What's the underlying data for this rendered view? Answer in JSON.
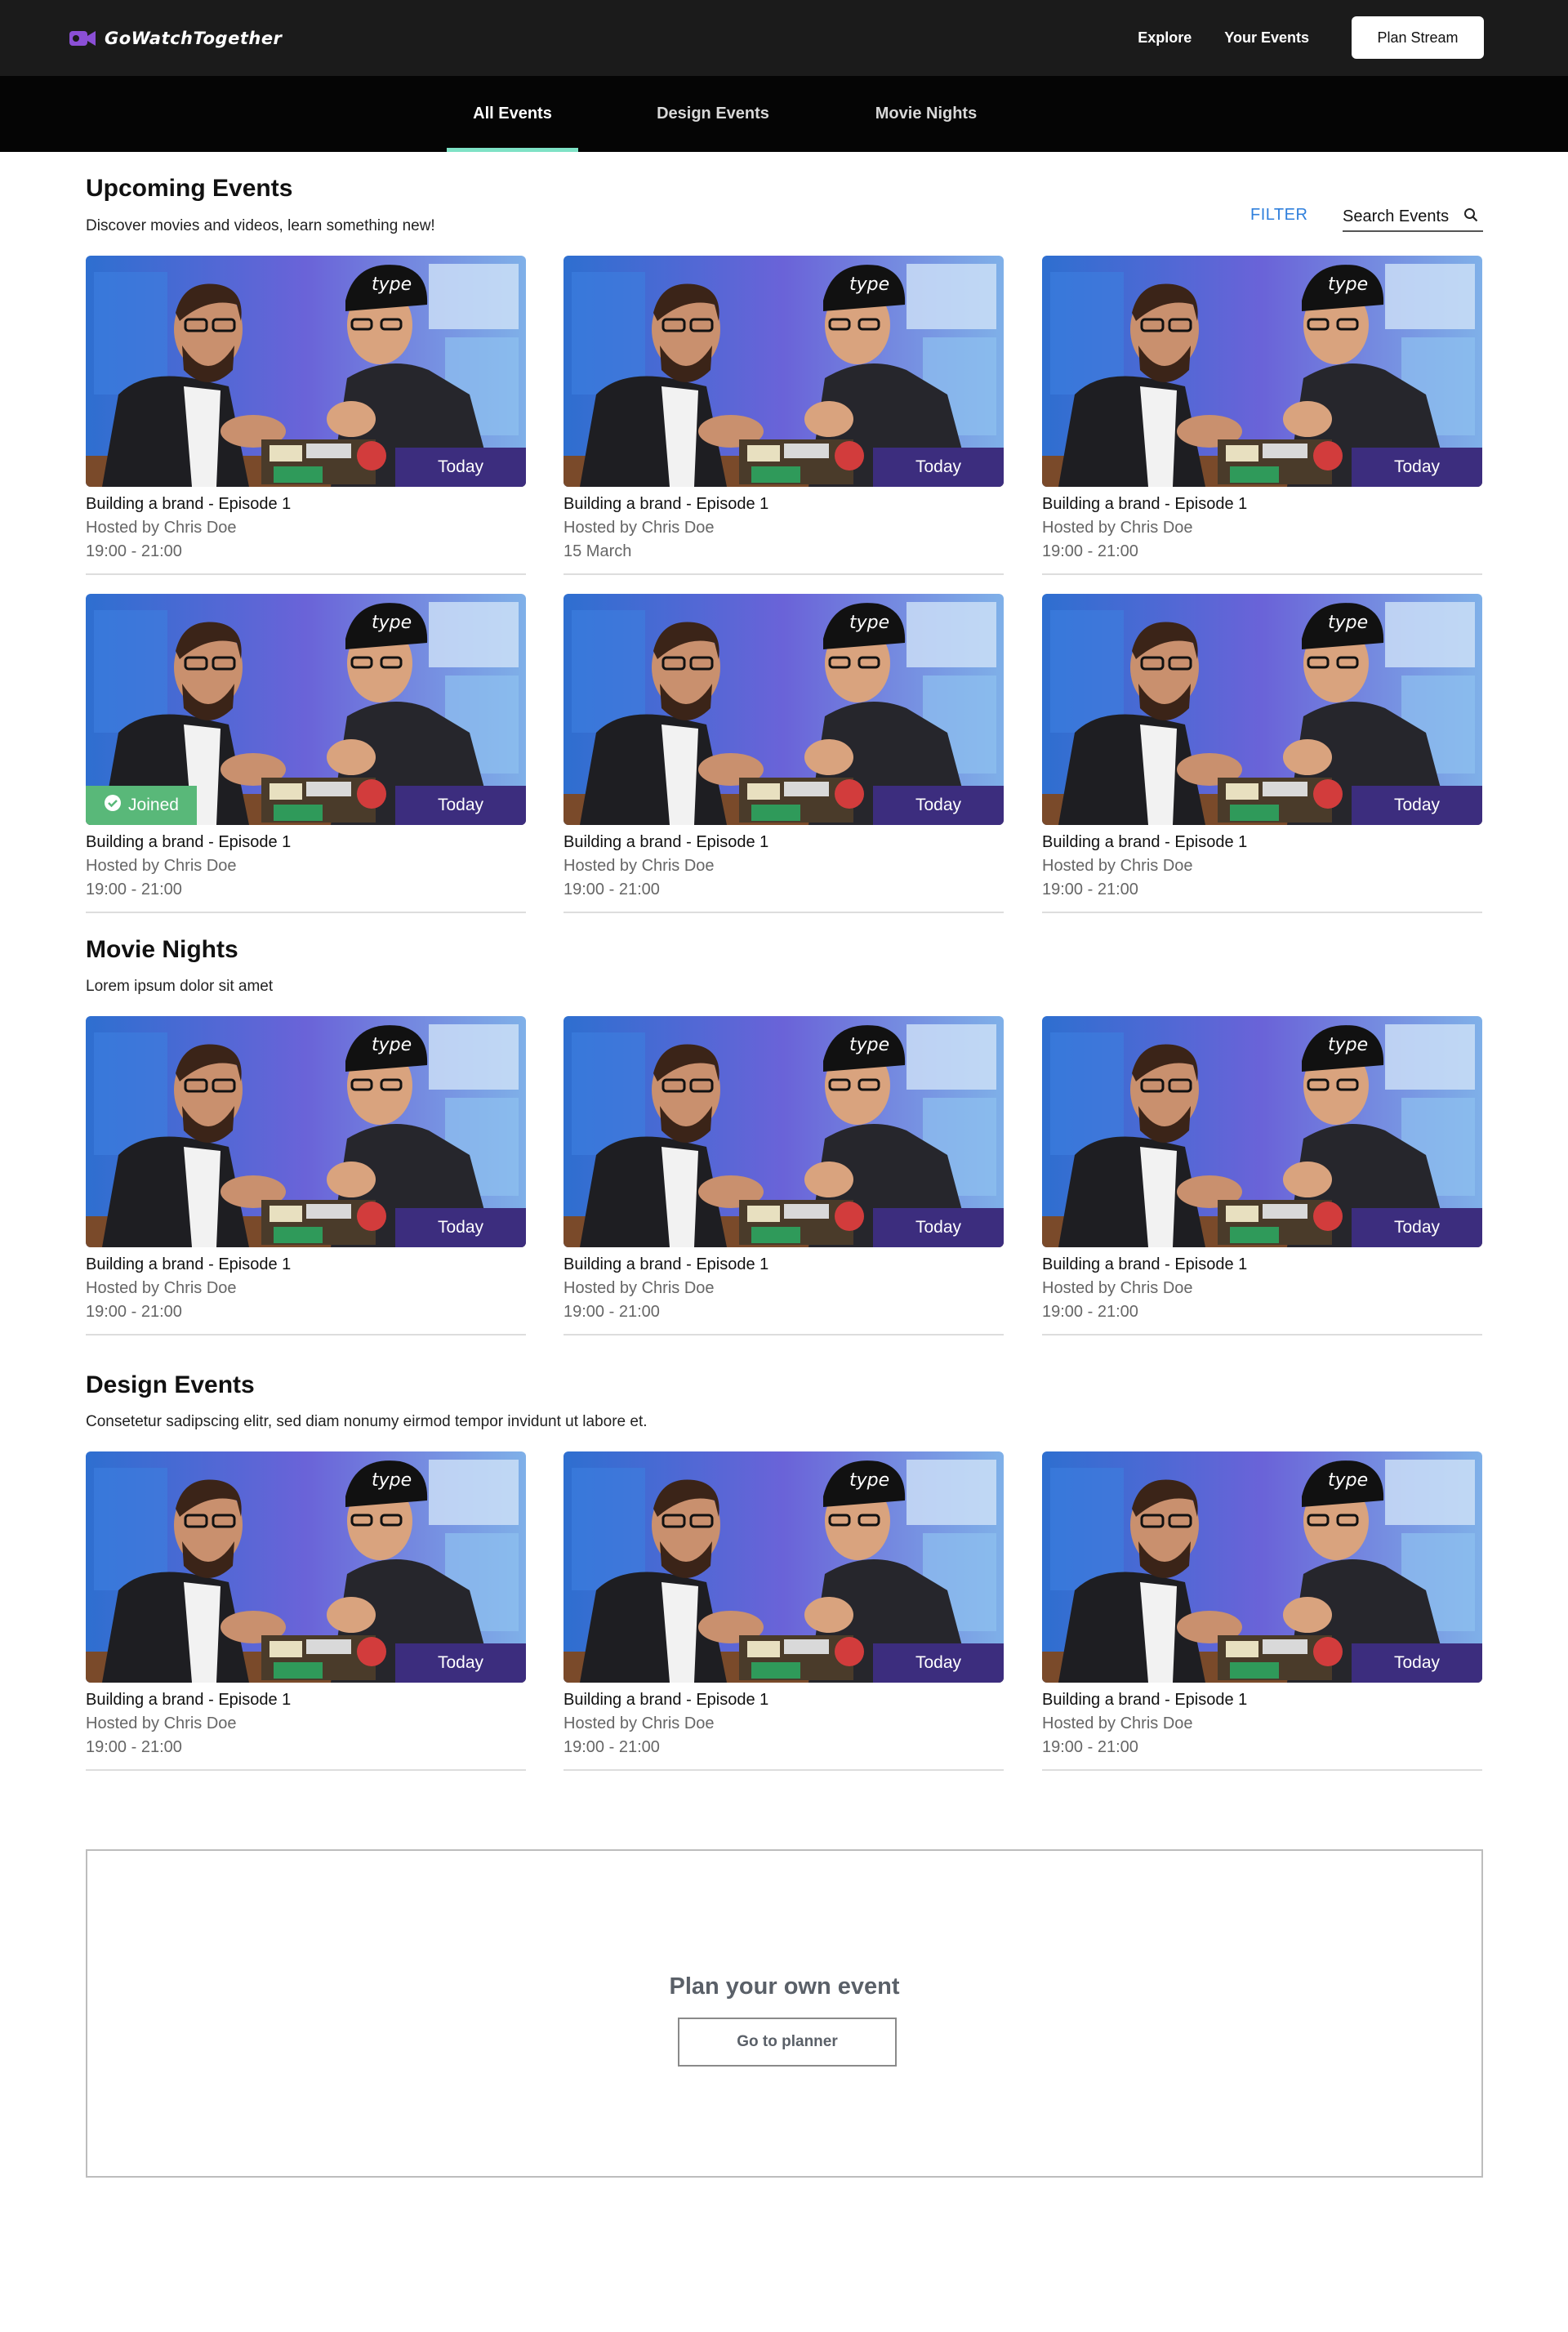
{
  "brand": {
    "name": "GoWatchTogether",
    "accent": "#8b4fd6"
  },
  "header": {
    "links": [
      "Explore",
      "Your Events"
    ],
    "plan_button": "Plan Stream"
  },
  "tabs": [
    {
      "label": "All Events",
      "active": true
    },
    {
      "label": "Design Events",
      "active": false
    },
    {
      "label": "Movie Nights",
      "active": false
    }
  ],
  "filter_label": "FILTER",
  "search": {
    "placeholder": "Search Events",
    "icon": "search-icon"
  },
  "sections": [
    {
      "title": "Upcoming Events",
      "subtitle": "Discover movies and videos, learn something new!",
      "cards": [
        {
          "title": "Building a brand - Episode 1",
          "host": "Hosted by Chris Doe",
          "time": "19:00 - 21:00",
          "badge": "Today"
        },
        {
          "title": "Building a brand - Episode 1",
          "host": "Hosted by Chris Doe",
          "time": "15 March",
          "badge": "Today"
        },
        {
          "title": "Building a brand - Episode 1",
          "host": "Hosted by Chris Doe",
          "time": "19:00 - 21:00",
          "badge": "Today"
        },
        {
          "title": "Building a brand - Episode 1",
          "host": "Hosted by Chris Doe",
          "time": "19:00 - 21:00",
          "badge": "Today",
          "joined": "Joined"
        },
        {
          "title": "Building a brand - Episode 1",
          "host": "Hosted by Chris Doe",
          "time": "19:00 - 21:00",
          "badge": "Today"
        },
        {
          "title": "Building a brand - Episode 1",
          "host": "Hosted by Chris Doe",
          "time": "19:00 - 21:00",
          "badge": "Today"
        }
      ]
    },
    {
      "title": "Movie Nights",
      "subtitle": "Lorem ipsum dolor sit amet",
      "cards": [
        {
          "title": "Building a brand - Episode 1",
          "host": "Hosted by Chris Doe",
          "time": "19:00 - 21:00",
          "badge": "Today"
        },
        {
          "title": "Building a brand - Episode 1",
          "host": "Hosted by Chris Doe",
          "time": "19:00 - 21:00",
          "badge": "Today"
        },
        {
          "title": "Building a brand - Episode 1",
          "host": "Hosted by Chris Doe",
          "time": "19:00 - 21:00",
          "badge": "Today"
        }
      ]
    },
    {
      "title": "Design Events",
      "subtitle": "Consetetur sadipscing elitr, sed diam nonumy eirmod tempor invidunt ut labore et.",
      "cards": [
        {
          "title": "Building a brand - Episode 1",
          "host": "Hosted by Chris Doe",
          "time": "19:00 - 21:00",
          "badge": "Today"
        },
        {
          "title": "Building a brand - Episode 1",
          "host": "Hosted by Chris Doe",
          "time": "19:00 - 21:00",
          "badge": "Today"
        },
        {
          "title": "Building a brand - Episode 1",
          "host": "Hosted by Chris Doe",
          "time": "19:00 - 21:00",
          "badge": "Today"
        }
      ]
    }
  ],
  "planner": {
    "title": "Plan your own event",
    "button": "Go to planner"
  }
}
